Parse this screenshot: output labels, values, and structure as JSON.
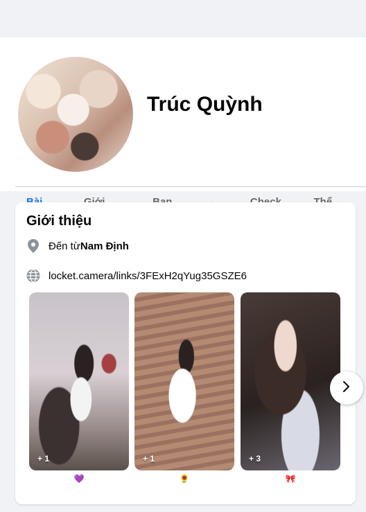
{
  "profile": {
    "name": "Trúc Quỳnh"
  },
  "tabs": [
    {
      "label": "Bài viết",
      "active": true
    },
    {
      "label": "Giới thiệu",
      "active": false
    },
    {
      "label": "Bạn bè",
      "active": false
    },
    {
      "label": "Ảnh",
      "active": false
    },
    {
      "label": "Check in",
      "active": false
    },
    {
      "label": "Thể thao",
      "active": false
    }
  ],
  "intro": {
    "title": "Giới thiệu",
    "hometown_prefix": "Đến từ ",
    "hometown": "Nam Định",
    "link": "locket.camera/links/3FExH2qYug35GSZE6",
    "icons": {
      "hometown": "location-pin-icon",
      "link": "globe-icon"
    }
  },
  "featured": [
    {
      "badge": "+ 1",
      "emoji": "💜"
    },
    {
      "badge": "+ 1",
      "emoji": "🌻"
    },
    {
      "badge": "+ 3",
      "emoji": "🎀"
    }
  ],
  "colors": {
    "accent": "#1b74e4",
    "muted": "#65676b",
    "page_bg": "#f0f2f5"
  }
}
